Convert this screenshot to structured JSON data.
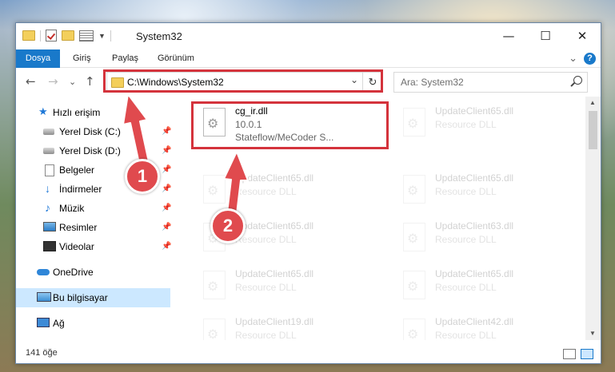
{
  "window": {
    "title": "System32",
    "minimize_glyph": "—",
    "maximize_glyph": "☐",
    "close_glyph": "✕"
  },
  "ribbon": {
    "tabs": [
      "Dosya",
      "Giriş",
      "Paylaş",
      "Görünüm"
    ],
    "collapse_glyph": "⌄",
    "help_glyph": "?"
  },
  "nav": {
    "back_glyph": "←",
    "forward_glyph": "→",
    "recent_glyph": "⌄",
    "up_glyph": "↑"
  },
  "address": {
    "path": "C:\\Windows\\System32",
    "dropdown_glyph": "⌄",
    "refresh_glyph": "↻"
  },
  "search": {
    "placeholder": "Ara: System32"
  },
  "sidebar": {
    "items": [
      {
        "label": "Hızlı erişim",
        "icon": "star-icon"
      },
      {
        "label": "Yerel Disk (C:)",
        "icon": "drive-icon"
      },
      {
        "label": "Yerel Disk (D:)",
        "icon": "drive-icon"
      },
      {
        "label": "Belgeler",
        "icon": "document-icon"
      },
      {
        "label": "İndirmeler",
        "icon": "download-icon"
      },
      {
        "label": "Müzik",
        "icon": "music-icon"
      },
      {
        "label": "Resimler",
        "icon": "pictures-icon"
      },
      {
        "label": "Videolar",
        "icon": "video-icon"
      },
      {
        "label": "OneDrive",
        "icon": "cloud-icon"
      },
      {
        "label": "Bu bilgisayar",
        "icon": "computer-icon"
      },
      {
        "label": "Ağ",
        "icon": "network-icon"
      }
    ],
    "pin_glyph": "📌"
  },
  "files": [
    {
      "name": "cg_ir.dll",
      "line1": "10.0.1",
      "line2": "Stateflow/MeCoder S..."
    },
    {
      "name": "UpdateClient65.dll",
      "line1": "Resource DLL"
    },
    {
      "name": "UpdateClient65.dll",
      "line1": "Resource DLL"
    },
    {
      "name": "UpdateClient65.dll",
      "line1": "Resource DLL"
    },
    {
      "name": "UpdateClient65.dll",
      "line1": "Resource DLL"
    },
    {
      "name": "UpdateClient63.dll",
      "line1": "Resource DLL"
    },
    {
      "name": "UpdateClient65.dll",
      "line1": "Resource DLL"
    },
    {
      "name": "UpdateClient65.dll",
      "line1": "Resource DLL"
    },
    {
      "name": "UpdateClient19.dll",
      "line1": "Resource DLL"
    },
    {
      "name": "UpdateClient42.dll",
      "line1": "Resource DLL"
    }
  ],
  "status": {
    "item_count": "141 öğe"
  },
  "callouts": [
    "1",
    "2"
  ],
  "colors": {
    "accent": "#1979ca",
    "highlight": "#d4333c",
    "callout": "#e04a4e"
  }
}
